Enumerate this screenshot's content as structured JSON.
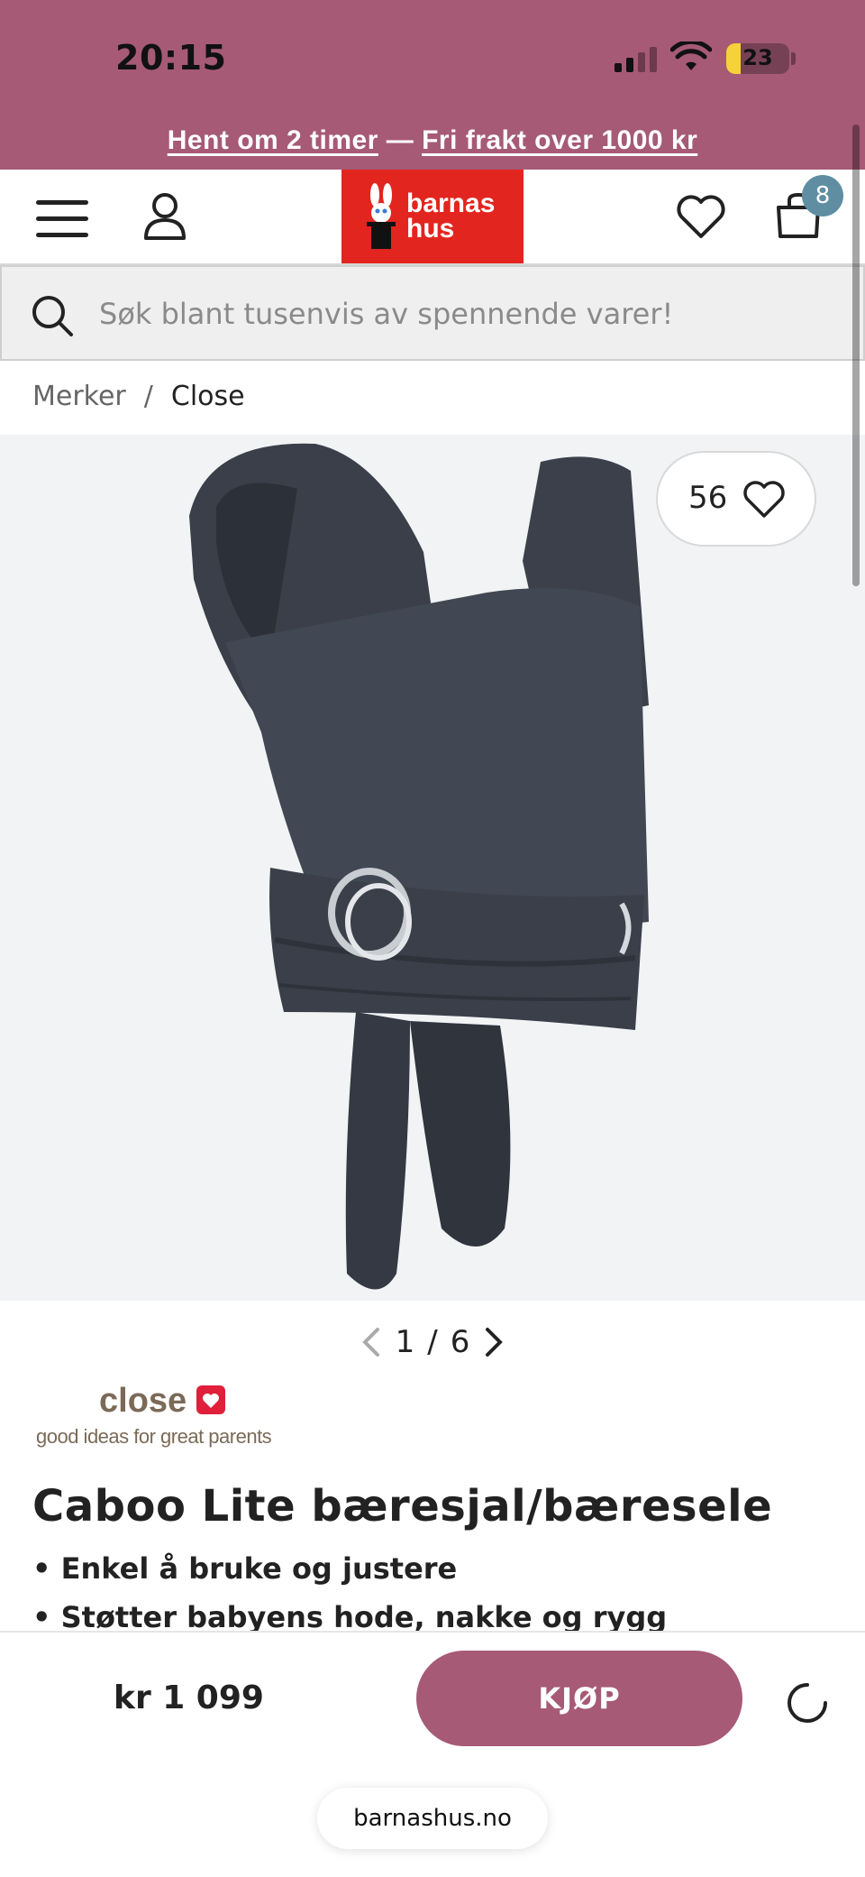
{
  "status_bar": {
    "time": "20:15",
    "battery": "23"
  },
  "promo": {
    "pickup": "Hent om 2 timer",
    "separator": "—",
    "shipping": "Fri frakt over 1000 kr"
  },
  "header": {
    "logo_line1": "barnas",
    "logo_line2": "hus",
    "cart_count": "8",
    "brand_color": "#e3251f",
    "accent_color": "#a65a76"
  },
  "search": {
    "placeholder": "Søk blant tusenvis av spennende varer!"
  },
  "breadcrumb": {
    "items": [
      "Merker",
      "Close"
    ],
    "separator": "/"
  },
  "gallery": {
    "favorites": "56",
    "current": "1",
    "separator": "/",
    "total": "6"
  },
  "brand": {
    "name": "close",
    "tagline": "good ideas for great parents"
  },
  "product": {
    "title": "Caboo Lite bæresjal/bæresele",
    "bullets": [
      "• Enkel å bruke og justere",
      "• Støtter babyens hode, nakke og rygg"
    ]
  },
  "purchase": {
    "price": "kr 1 099",
    "buy_label": "KJØP"
  },
  "browser": {
    "url": "barnashus.no"
  },
  "icons": [
    "menu-icon",
    "user-icon",
    "heart-icon",
    "cart-icon",
    "search-icon",
    "chevron-left-icon",
    "chevron-right-icon",
    "loading-spinner-icon"
  ]
}
